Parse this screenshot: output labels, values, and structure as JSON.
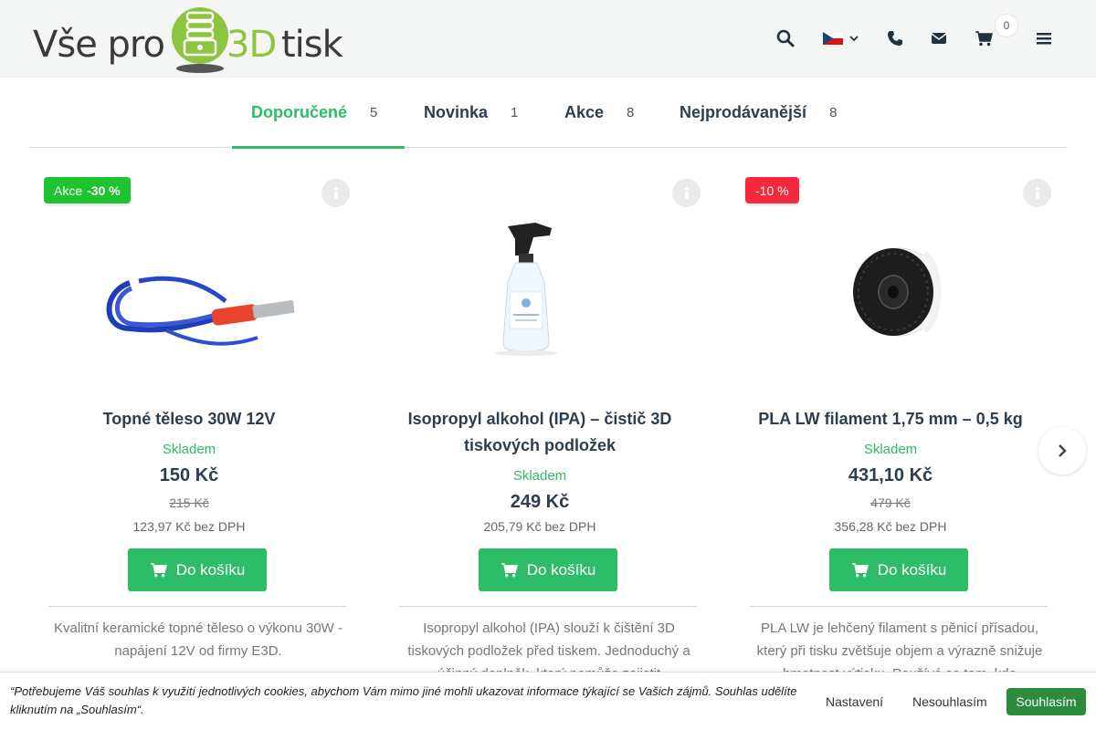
{
  "header": {
    "logo": {
      "part1": "Vše pro",
      "part2": "3D",
      "part3": "tisk"
    },
    "cart_count": "0",
    "language": "CZ"
  },
  "tabs": [
    {
      "label": "Doporučené",
      "count": "5",
      "active": true
    },
    {
      "label": "Novinka",
      "count": "1",
      "active": false
    },
    {
      "label": "Akce",
      "count": "8",
      "active": false
    },
    {
      "label": "Nejprodávanější",
      "count": "8",
      "active": false
    }
  ],
  "products": [
    {
      "badge_label": "Akce",
      "badge_value": "-30 %",
      "title": "Topné těleso 30W 12V",
      "stock": "Skladem",
      "price": "150 Kč",
      "old_price": "215 Kč",
      "net_price": "123,97 Kč bez DPH",
      "button": "Do košíku",
      "description": "Kvalitní keramické topné těleso o výkonu 30W - napájení 12V od firmy E3D."
    },
    {
      "title_line1": "Isopropyl alkohol (IPA) – čistič 3D",
      "title_line2": "tiskových podložek",
      "stock": "Skladem",
      "price": "249 Kč",
      "net_price": "205,79 Kč bez DPH",
      "button": "Do košíku",
      "description": "Isopropyl alkohol (IPA) slouží k čištění 3D tiskových podložek před tiskem. Jednoduchý a účinný doplněk, který pomůže zajistit"
    },
    {
      "badge_value": "-10 %",
      "title": "PLA LW filament 1,75 mm – 0,5 kg",
      "stock": "Skladem",
      "price": "431,10 Kč",
      "old_price": "479 Kč",
      "net_price": "356,28 Kč bez DPH",
      "button": "Do košíku",
      "description": "PLA LW je lehčený filament s pěnicí přísadou, který při tisku zvětšuje objem a výrazně snižuje hmotnost výtisku. Používá se tam, kde"
    }
  ],
  "cookie": {
    "message": "“Potřebujeme Váš souhlas k využití jednotlivých cookies, abychom Vám mimo jiné mohli ukazovat informace týkající se Vašich zájmů. Souhlas udělíte kliknutím na „Souhlasím“.",
    "settings": "Nastavení",
    "decline": "Nesouhlasím",
    "accept": "Souhlasím"
  },
  "colors": {
    "accent": "#2ebd67",
    "sale_badge": "#1ec32f",
    "discount_badge": "#f5283c",
    "accept_button": "#2c8c3c"
  }
}
